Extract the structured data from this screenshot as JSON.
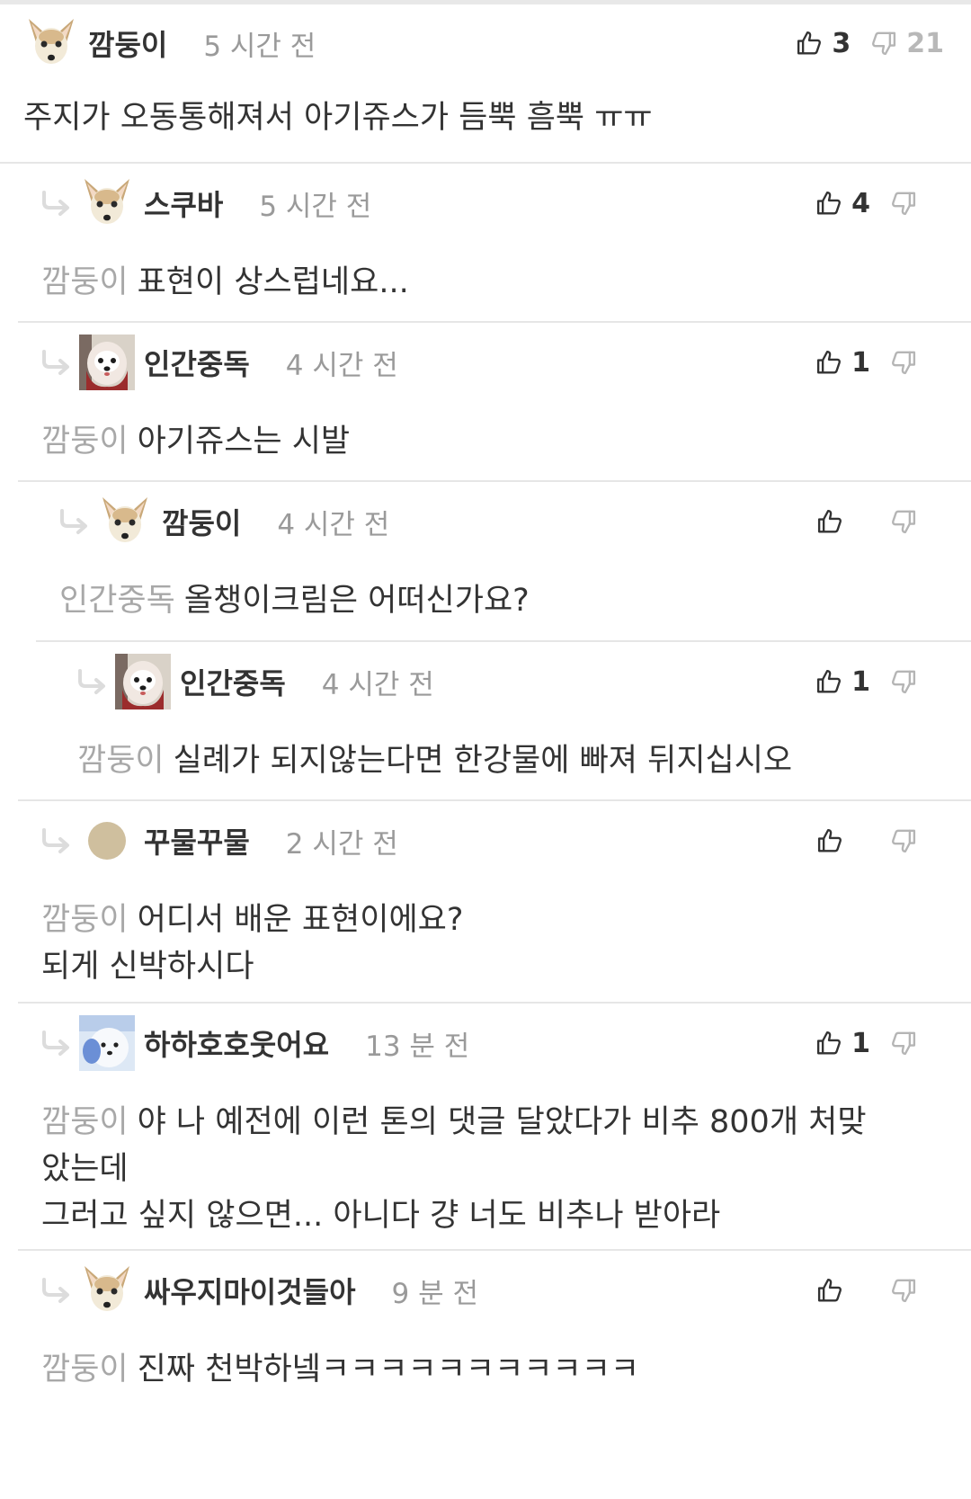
{
  "comments": [
    {
      "nick": "깜둥이",
      "time": "5 시간 전",
      "up": "3",
      "down": "21",
      "mention": "",
      "lines": [
        "주지가 오동통해져서 아기쥬스가 듬뿍 흠뿍 ㅠㅠ"
      ],
      "avatar": "chihuahua-avatar"
    },
    {
      "nick": "스쿠바",
      "time": "5 시간 전",
      "up": "4",
      "down": "",
      "mention": "깜둥이",
      "lines": [
        "표현이 상스럽네요..."
      ],
      "avatar": "chihuahua-avatar"
    },
    {
      "nick": "인간중독",
      "time": "4 시간 전",
      "up": "1",
      "down": "",
      "mention": "깜둥이",
      "lines": [
        "아기쥬스는 시발"
      ],
      "avatar": "dog-photo-avatar"
    },
    {
      "nick": "깜둥이",
      "time": "4 시간 전",
      "up": "",
      "down": "",
      "mention": "인간중독",
      "lines": [
        "올챙이크림은 어떠신가요?"
      ],
      "avatar": "chihuahua-avatar"
    },
    {
      "nick": "인간중독",
      "time": "4 시간 전",
      "up": "1",
      "down": "",
      "mention": "깜둥이",
      "lines": [
        "실례가 되지않는다면 한강물에 빠져 뒤지십시오"
      ],
      "avatar": "dog-photo-avatar"
    },
    {
      "nick": "꾸물꾸물",
      "time": "2 시간 전",
      "up": "",
      "down": "",
      "mention": "깜둥이",
      "lines": [
        "어디서 배운 표현이에요?",
        "되게 신박하시다"
      ],
      "avatar": "default-circle-avatar"
    },
    {
      "nick": "하하호호웃어요",
      "time": "13 분 전",
      "up": "1",
      "down": "",
      "mention": "깜둥이",
      "lines": [
        "야 나 예전에 이런 톤의 댓글 달았다가 비추 800개 처맞",
        "았는데",
        "그러고 싶지 않으면... 아니다 걍 너도 비추나 받아라"
      ],
      "avatar": "white-dog-avatar"
    },
    {
      "nick": "싸우지마이것들아",
      "time": "9 분 전",
      "up": "",
      "down": "",
      "mention": "깜둥이",
      "lines": [
        "진짜 천박하넼ㅋㅋㅋㅋㅋㅋㅋㅋㅋㅋㅋ"
      ],
      "avatar": "chihuahua-avatar"
    }
  ],
  "icons": {
    "like": "thumbs-up-icon",
    "dislike": "thumbs-down-icon",
    "reply": "reply-arrow-icon"
  },
  "colors": {
    "text": "#333333",
    "muted": "#9a9a9a",
    "mention": "#a8a8a8",
    "divider": "#e6e6e6"
  }
}
